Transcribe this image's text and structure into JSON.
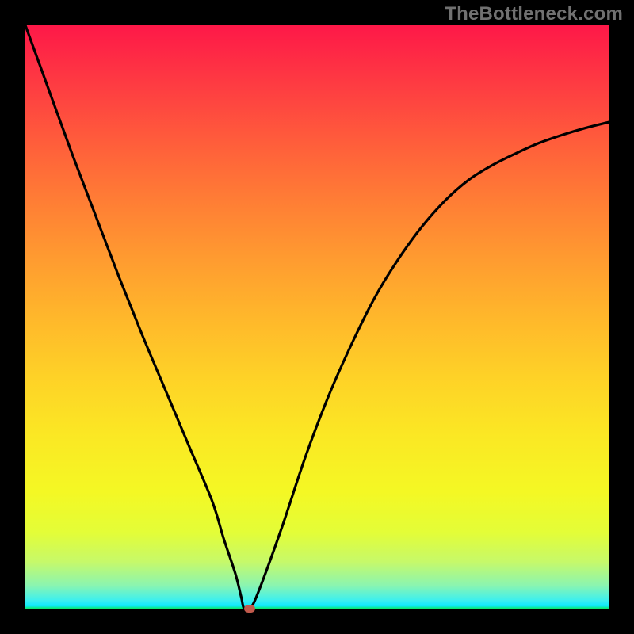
{
  "watermark": "TheBottleneck.com",
  "chart_data": {
    "type": "line",
    "title": "",
    "xlabel": "",
    "ylabel": "",
    "xlim": [
      0,
      100
    ],
    "ylim": [
      0,
      100
    ],
    "grid": false,
    "legend": false,
    "annotations": [],
    "series": [
      {
        "name": "bottleneck-curve",
        "color": "#000000",
        "x": [
          0,
          4,
          8,
          12,
          16,
          20,
          24,
          28,
          32,
          34,
          36,
          37,
          37.5,
          38.5,
          40,
          44,
          48,
          52,
          56,
          60,
          64,
          68,
          72,
          76,
          80,
          84,
          88,
          92,
          96,
          100
        ],
        "values": [
          100,
          89,
          78,
          67.5,
          57,
          47,
          37.5,
          28,
          18.5,
          12,
          6,
          2,
          0,
          0,
          3,
          14,
          26,
          36.5,
          45.5,
          53.5,
          60,
          65.5,
          70,
          73.5,
          76,
          78,
          79.8,
          81.2,
          82.4,
          83.4
        ]
      }
    ],
    "marker": {
      "x": 38.5,
      "y": 0,
      "color": "#c15a4c"
    },
    "background_gradient": {
      "direction": "top-to-bottom",
      "stops": [
        {
          "pos": 0,
          "color": "#fe1848"
        },
        {
          "pos": 0.5,
          "color": "#ffb72b"
        },
        {
          "pos": 0.87,
          "color": "#e3fd38"
        },
        {
          "pos": 1.0,
          "color": "#0ae960"
        }
      ]
    },
    "frame_color": "#000000"
  }
}
